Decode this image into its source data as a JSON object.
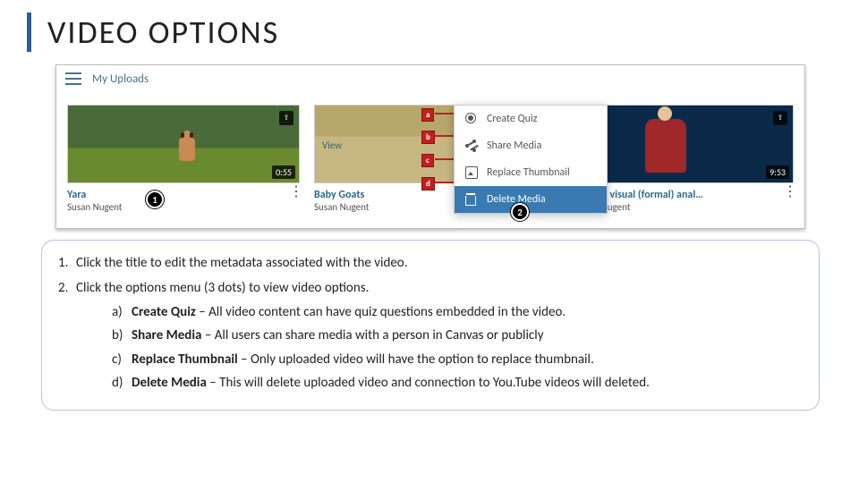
{
  "title": "VIDEO OPTIONS",
  "panel": {
    "header": "My Uploads",
    "cards": [
      {
        "title": "Yara",
        "author": "Susan Nugent",
        "time": "0:55",
        "yt": false
      },
      {
        "title": "Baby Goats",
        "author": "Susan Nugent",
        "time": "",
        "yt": false
      },
      {
        "title": "How to do visual (formal) anal…",
        "author": "Susan Nugent",
        "time": "9:53",
        "yt": true
      }
    ],
    "menu": [
      {
        "label": "Create Quiz"
      },
      {
        "label": "Share Media"
      },
      {
        "label": "Replace Thumbnail"
      },
      {
        "label": "Delete Media"
      }
    ],
    "view_label": "View",
    "letters": [
      "a",
      "b",
      "c",
      "d"
    ],
    "numbers": [
      "1",
      "2"
    ]
  },
  "instructions": {
    "item1": "Click the title to edit the metadata associated with the video.",
    "item2": "Click the options menu (3 dots) to view video options.",
    "a_label": "Create Quiz",
    "a_text": " – All video content can have quiz questions embedded in the video.",
    "b_label": "Share Media",
    "b_text": " – All users can share media with a person in Canvas or publicly",
    "c_label": "Replace Thumbnail",
    "c_text": " – Only uploaded video will have the option to replace thumbnail.",
    "d_label": "Delete Media",
    "d_text": " – This will delete uploaded video and connection to You.Tube videos will deleted."
  }
}
